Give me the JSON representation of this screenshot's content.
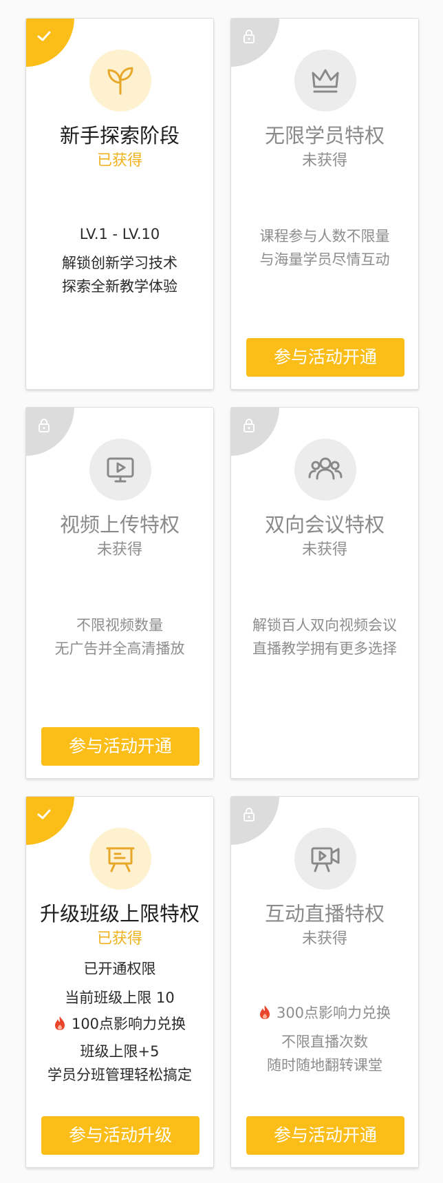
{
  "colors": {
    "accent": "#fbbd17",
    "earned_text": "#f0b21c",
    "locked_corner": "#dcdcdc",
    "flame": "#e8452c"
  },
  "cards": [
    {
      "state": "earned",
      "icon": "sprout-icon",
      "title": "新手探索阶段",
      "status": "已获得",
      "level": "LV.1 - LV.10",
      "desc1": "解锁创新学习技术",
      "desc2": "探索全新教学体验"
    },
    {
      "state": "locked",
      "icon": "crown-icon",
      "title": "无限学员特权",
      "status": "未获得",
      "desc1": "课程参与人数不限量",
      "desc2": "与海量学员尽情互动",
      "button": "参与活动开通"
    },
    {
      "state": "locked",
      "icon": "video-screen-icon",
      "title": "视频上传特权",
      "status": "未获得",
      "desc1": "不限视频数量",
      "desc2": "无广告并全高清播放",
      "button": "参与活动开通"
    },
    {
      "state": "locked",
      "icon": "group-icon",
      "title": "双向会议特权",
      "status": "未获得",
      "desc1": "解锁百人双向视频会议",
      "desc2": "直播教学拥有更多选择"
    },
    {
      "state": "earned",
      "icon": "presentation-board-icon",
      "title": "升级班级上限特权",
      "status": "已获得",
      "line1": "已开通权限",
      "line2": "当前班级上限 10",
      "points": "100点影响力兑换",
      "line3": "班级上限+5",
      "line4": "学员分班管理轻松搞定",
      "button": "参与活动升级"
    },
    {
      "state": "locked",
      "icon": "video-camera-icon",
      "title": "互动直播特权",
      "status": "未获得",
      "points": "300点影响力兑换",
      "desc1": "不限直播次数",
      "desc2": "随时随地翻转课堂",
      "button": "参与活动开通"
    }
  ]
}
